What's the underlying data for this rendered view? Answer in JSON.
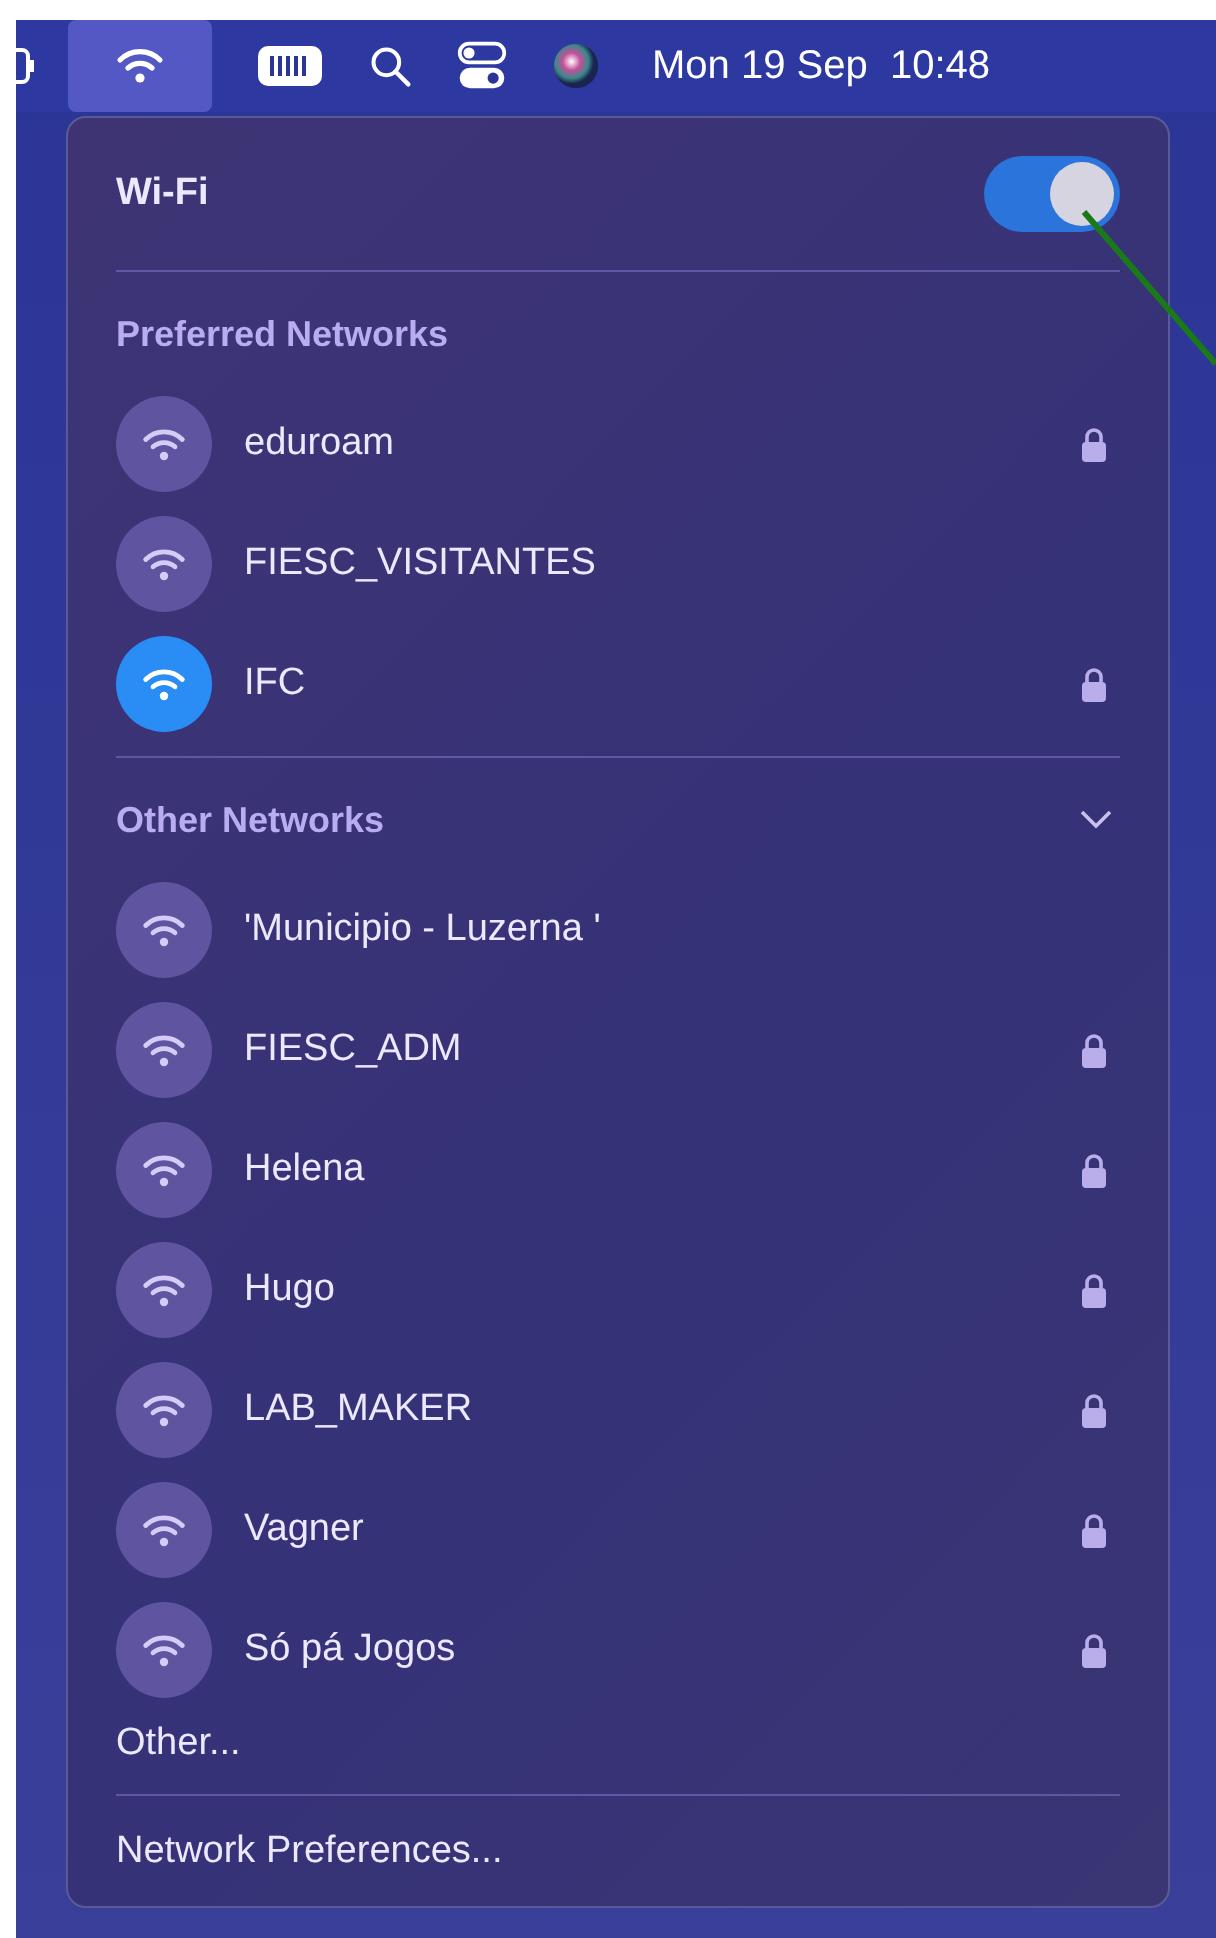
{
  "menu_bar": {
    "clock": "Mon 19 Sep  10:48"
  },
  "wifi": {
    "title": "Wi-Fi",
    "on": true
  },
  "preferred": {
    "heading": "Preferred Networks",
    "networks": [
      {
        "name": "eduroam",
        "selected": false,
        "locked": true
      },
      {
        "name": "FIESC_VISITANTES",
        "selected": false,
        "locked": false
      },
      {
        "name": "IFC",
        "selected": true,
        "locked": true
      }
    ]
  },
  "other": {
    "heading": "Other Networks",
    "expanded": true,
    "networks": [
      {
        "name": "'Municipio - Luzerna '",
        "selected": false,
        "locked": false
      },
      {
        "name": "FIESC_ADM",
        "selected": false,
        "locked": true
      },
      {
        "name": "Helena",
        "selected": false,
        "locked": true
      },
      {
        "name": "Hugo",
        "selected": false,
        "locked": true
      },
      {
        "name": "LAB_MAKER",
        "selected": false,
        "locked": true
      },
      {
        "name": "Vagner",
        "selected": false,
        "locked": true
      },
      {
        "name": "Só pá Jogos",
        "selected": false,
        "locked": true
      }
    ]
  },
  "other_item": "Other...",
  "preferences_item": "Network Preferences..."
}
